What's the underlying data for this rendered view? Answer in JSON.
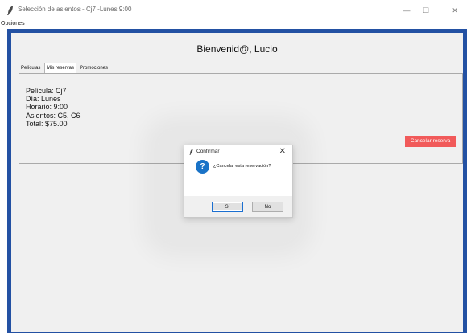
{
  "window": {
    "title": "Selección de asientos - Cj7 -Lunes 9:00",
    "controls": {
      "minimize": "—",
      "maximize": "☐",
      "close": "✕"
    }
  },
  "menu": {
    "opciones": "Opciones"
  },
  "header": {
    "welcome": "Bienvenid@, Lucio"
  },
  "tabs": [
    {
      "label": "Películas"
    },
    {
      "label": "Mis reservas"
    },
    {
      "label": "Promociones"
    }
  ],
  "reservation": {
    "lines": [
      "Película: Cj7",
      "Día: Lunes",
      "Horario: 9:00",
      "Asientos: C5, C6",
      "Total: $75.00"
    ],
    "cancel_label": "Cancelar reserva"
  },
  "dialog": {
    "title": "Confirmar",
    "close": "✕",
    "icon": "question-icon",
    "icon_glyph": "?",
    "message": "¿Cancelar esta reservación?",
    "yes_label": "Sí",
    "no_label": "No"
  },
  "colors": {
    "frame": "#2351a3",
    "cancel_button": "#f15a5a",
    "question_icon": "#1a73c7"
  }
}
